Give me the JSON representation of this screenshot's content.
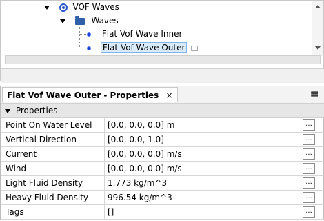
{
  "tree": {
    "root": {
      "label": "VOF Waves"
    },
    "folder": {
      "label": "Waves"
    },
    "items": [
      {
        "label": "Flat Vof Wave Inner"
      },
      {
        "label": "Flat Vof Wave Outer"
      }
    ],
    "vof_icon": "vof-waves-icon",
    "folder_icon": "folder-icon",
    "item_icon": "wave-item-icon"
  },
  "panel": {
    "tab_title": "Flat Vof Wave Outer - Properties",
    "close_glyph": "×",
    "menu_glyph": "≡",
    "section_title": "Properties",
    "button_label": "...",
    "properties": [
      {
        "name": "Point On Water Level",
        "value": "[0.0, 0.0, 0.0] m"
      },
      {
        "name": "Vertical Direction",
        "value": "[0.0, 0.0, 1.0]"
      },
      {
        "name": "Current",
        "value": "[0.0, 0.0, 0.0] m/s"
      },
      {
        "name": "Wind",
        "value": "[0.0, 0.0, 0.0] m/s"
      },
      {
        "name": "Light Fluid Density",
        "value": "1.773 kg/m^3"
      },
      {
        "name": "Heavy Fluid Density",
        "value": "996.54 kg/m^3"
      },
      {
        "name": "Tags",
        "value": "[]"
      }
    ]
  },
  "colors": {
    "accent": "#2b58c8",
    "selection_bg": "#d9ebf9"
  }
}
